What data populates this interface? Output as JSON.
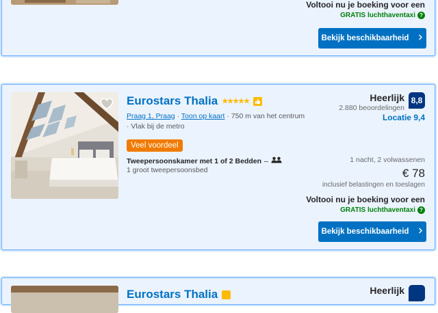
{
  "cards": {
    "top": {
      "complete_text": "Voltooi nu je boeking voor een",
      "taxi_text": "GRATIS luchthaventaxi",
      "cta_label": "Bekijk beschikbaarheid",
      "cta_icon": "chevron-right-icon"
    },
    "main": {
      "name": "Eurostars Thalia",
      "stars": "★★★★★",
      "city_link": "Praag 1, Praag",
      "map_link": "Toon op kaart",
      "distance": "750 m van het centrum",
      "metro": "Vlak bij de metro",
      "deal_badge": "Veel voordeel",
      "room": "Tweepersoonskamer met 1 of 2 Bedden",
      "room_dash": "–",
      "bed": "1 groot tweepersoonsbed",
      "review_word": "Heerlijk",
      "review_count": "2.880 beoordelingen",
      "score": "8,8",
      "location_score": "Locatie 9,4",
      "stay_info": "1 nacht, 2 volwassenen",
      "price": "€ 78",
      "price_note": "inclusief belastingen en toeslagen",
      "complete_text": "Voltooi nu je boeking voor een",
      "taxi_text": "GRATIS luchthaventaxi",
      "cta_label": "Bekijk beschikbaarheid",
      "favorite_icon": "heart-icon",
      "thumb_icon": "thumbs-up-icon",
      "occupancy_icon": "two-persons-icon",
      "cta_icon": "chevron-right-icon"
    },
    "bottom": {
      "name_partial": "Eurostars Thalia",
      "review_word": "Heerlijk"
    }
  },
  "colors": {
    "card_bg": "#ebf3ff",
    "card_border": "#6ab0ff",
    "link_blue": "#0071c2",
    "score_bg": "#003580",
    "deal_orange": "#f07b00",
    "free_green": "#008009",
    "star_yellow": "#febb02"
  }
}
